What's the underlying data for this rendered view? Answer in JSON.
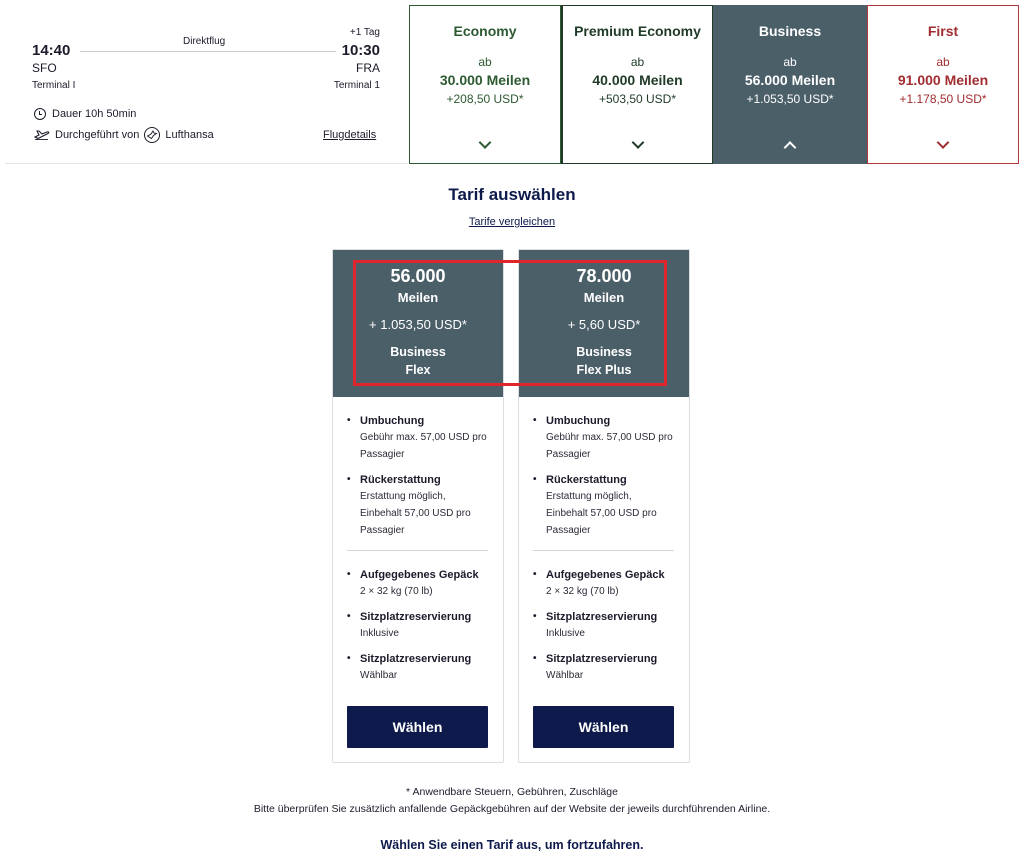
{
  "flight": {
    "departure_time": "14:40",
    "departure_code": "SFO",
    "departure_terminal": "Terminal I",
    "arrival_time": "10:30",
    "arrival_code": "FRA",
    "arrival_terminal": "Terminal 1",
    "plus_day": "+1 Tag",
    "direct_label": "Direktflug",
    "duration": "Dauer 10h 50min",
    "operated_by_label": "Durchgeführt von",
    "airline": "Lufthansa",
    "details_link": "Flugdetails"
  },
  "cabins": [
    {
      "name": "Economy",
      "ab": "ab",
      "miles": "30.000 Meilen",
      "usd": "+208,50 USD*",
      "state": "collapsed"
    },
    {
      "name": "Premium Economy",
      "ab": "ab",
      "miles": "40.000 Meilen",
      "usd": "+503,50 USD*",
      "state": "collapsed"
    },
    {
      "name": "Business",
      "ab": "ab",
      "miles": "56.000 Meilen",
      "usd": "+1.053,50 USD*",
      "state": "expanded"
    },
    {
      "name": "First",
      "ab": "ab",
      "miles": "91.000 Meilen",
      "usd": "+1.178,50 USD*",
      "state": "collapsed"
    }
  ],
  "section": {
    "title": "Tarif auswählen",
    "compare_link": "Tarife vergleichen"
  },
  "fares": [
    {
      "miles": "56.000",
      "unit": "Meilen",
      "usd": "+ 1.053,50 USD*",
      "name_line1": "Business",
      "name_line2": "Flex",
      "features": {
        "rebooking_title": "Umbuchung",
        "rebooking_line1": "Gebühr max. 57,00 USD pro",
        "rebooking_line2": "Passagier",
        "refund_title": "Rückerstattung",
        "refund_line1": "Erstattung möglich,",
        "refund_line2": "Einbehalt 57,00 USD pro",
        "refund_line3": "Passagier",
        "baggage_title": "Aufgegebenes Gepäck",
        "baggage_line1": "2 × 32 kg (70 lb)",
        "seat1_title": "Sitzplatzreservierung",
        "seat1_line1": "Inklusive",
        "seat2_title": "Sitzplatzreservierung",
        "seat2_line1": "Wählbar"
      },
      "button": "Wählen"
    },
    {
      "miles": "78.000",
      "unit": "Meilen",
      "usd": "+ 5,60 USD*",
      "name_line1": "Business",
      "name_line2": "Flex Plus",
      "features": {
        "rebooking_title": "Umbuchung",
        "rebooking_line1": "Gebühr max. 57,00 USD pro",
        "rebooking_line2": "Passagier",
        "refund_title": "Rückerstattung",
        "refund_line1": "Erstattung möglich,",
        "refund_line2": "Einbehalt 57,00 USD pro",
        "refund_line3": "Passagier",
        "baggage_title": "Aufgegebenes Gepäck",
        "baggage_line1": "2 × 32 kg (70 lb)",
        "seat1_title": "Sitzplatzreservierung",
        "seat1_line1": "Inklusive",
        "seat2_title": "Sitzplatzreservierung",
        "seat2_line1": "Wählbar"
      },
      "button": "Wählen"
    }
  ],
  "footer": {
    "note1": "* Anwendbare Steuern, Gebühren, Zuschläge",
    "note2": "Bitte überprüfen Sie zusätzlich anfallende Gepäckgebühren auf der Website der jeweils durchführenden Airline.",
    "cta": "Wählen Sie einen Tarif aus, um fortzufahren."
  },
  "colors": {
    "economy": "#2d5a31",
    "business_bg": "#4b5f69",
    "first": "#a12d31",
    "primary_button": "#0e1a4b",
    "highlight": "#e0262d"
  }
}
